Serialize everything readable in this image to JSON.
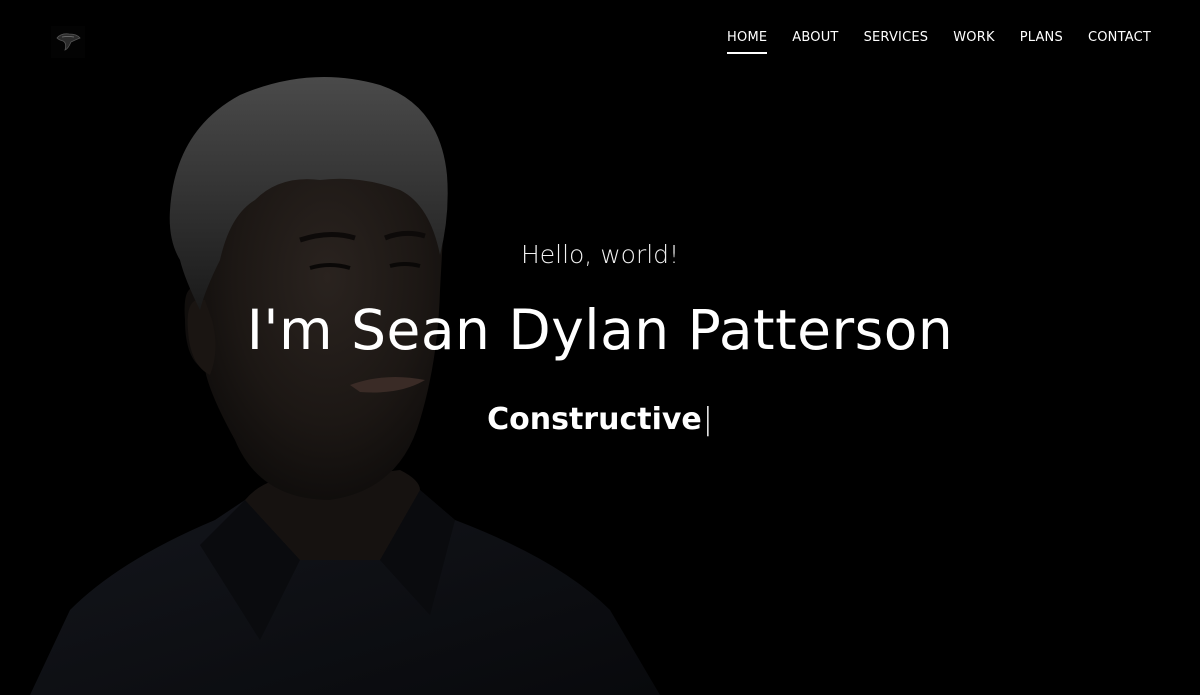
{
  "nav": {
    "items": [
      {
        "label": "HOME",
        "active": true
      },
      {
        "label": "ABOUT",
        "active": false
      },
      {
        "label": "SERVICES",
        "active": false
      },
      {
        "label": "WORK",
        "active": false
      },
      {
        "label": "PLANS",
        "active": false
      },
      {
        "label": "CONTACT",
        "active": false
      }
    ]
  },
  "hero": {
    "greeting": "Hello, world!",
    "headline": "I'm Sean Dylan Patterson",
    "typed_word": "Constructive",
    "cursor": "|"
  },
  "colors": {
    "background": "#000000",
    "text": "#ffffff"
  },
  "icons": {
    "logo": "logo-icon"
  }
}
